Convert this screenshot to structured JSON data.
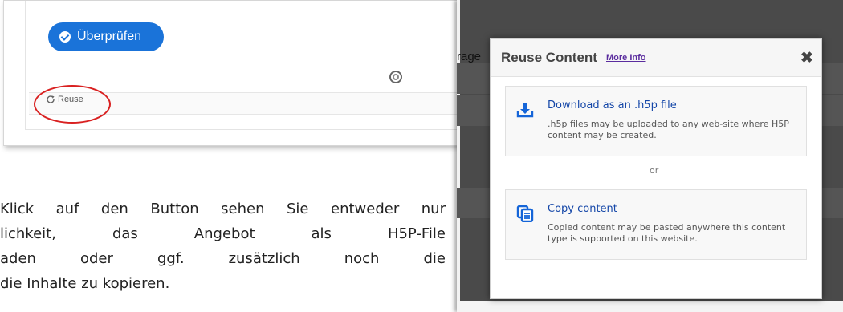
{
  "left_card": {
    "check_button_label": "Überprüfen",
    "reuse_label": "Reuse"
  },
  "paragraph": {
    "line1": [
      "Klick",
      "auf",
      "den",
      "Button",
      "sehen",
      "Sie",
      "entweder",
      "nur"
    ],
    "line2": [
      "lichkeit,",
      "das",
      "Angebot",
      "als",
      "H5P-File"
    ],
    "line3": [
      "aden",
      "oder",
      "ggf.",
      "zusätzlich",
      "noch",
      "die"
    ],
    "line4": "die Inhalte zu kopieren."
  },
  "background_page": {
    "partial_text": "rage"
  },
  "dialog": {
    "title": "Reuse Content",
    "more_info": "More Info",
    "close_glyph": "✖",
    "download": {
      "title": "Download as an .h5p file",
      "description": ".h5p files may be uploaded to any web-site where H5P content may be created."
    },
    "separator": "or",
    "copy": {
      "title": "Copy content",
      "description": "Copied content may be pasted anywhere this content type is supported on this website."
    }
  },
  "colors": {
    "button_blue": "#1a73d9",
    "link_blue": "#1547a8",
    "more_info_purple": "#5a2c9e",
    "highlight_red": "#d92121",
    "overlay_dark": "#4a4a4a"
  }
}
